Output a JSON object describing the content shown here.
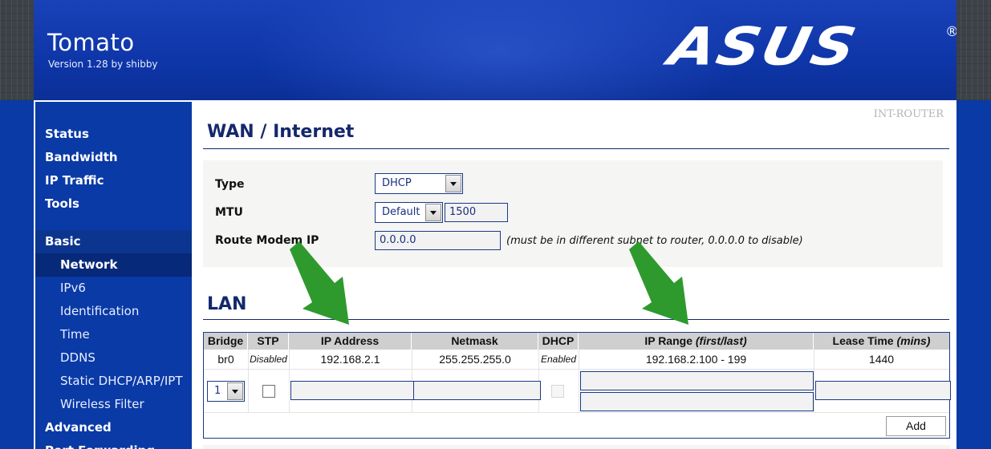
{
  "header": {
    "title": "Tomato",
    "version": "Version 1.28 by shibby",
    "brand": "ASUS",
    "brand_mark": "®"
  },
  "sidebar": {
    "items": [
      {
        "label": "Status"
      },
      {
        "label": "Bandwidth"
      },
      {
        "label": "IP Traffic"
      },
      {
        "label": "Tools"
      }
    ],
    "section": "Basic",
    "sub_items": [
      {
        "label": "Network",
        "active": true
      },
      {
        "label": "IPv6"
      },
      {
        "label": "Identification"
      },
      {
        "label": "Time"
      },
      {
        "label": "DDNS"
      },
      {
        "label": "Static DHCP/ARP/IPT"
      },
      {
        "label": "Wireless Filter"
      }
    ],
    "after_items": [
      {
        "label": "Advanced"
      },
      {
        "label": "Port Forwarding"
      }
    ]
  },
  "main": {
    "router_name": "INT-ROUTER",
    "wan": {
      "title": "WAN / Internet",
      "type_label": "Type",
      "type_value": "DHCP",
      "mtu_label": "MTU",
      "mtu_mode": "Default",
      "mtu_value": "1500",
      "route_label": "Route Modem IP",
      "route_value": "0.0.0.0",
      "route_hint": "(must be in different subnet to router, 0.0.0.0 to disable)"
    },
    "lan": {
      "title": "LAN",
      "columns": {
        "bridge": "Bridge",
        "stp": "STP",
        "ip": "IP Address",
        "netmask": "Netmask",
        "dhcp": "DHCP",
        "range": "IP Range",
        "range_note": "(first/last)",
        "lease": "Lease Time",
        "lease_note": "(mins)"
      },
      "row": {
        "bridge": "br0",
        "stp": "Disabled",
        "ip": "192.168.2.1",
        "netmask": "255.255.255.0",
        "dhcp": "Enabled",
        "range": "192.168.2.100 - 199",
        "lease": "1440"
      },
      "new_row_bridge": "1",
      "add_label": "Add"
    }
  },
  "colors": {
    "page_blue": "#0a3aa6",
    "heading_navy": "#14286c",
    "annotation_green": "#2e9a2e"
  }
}
